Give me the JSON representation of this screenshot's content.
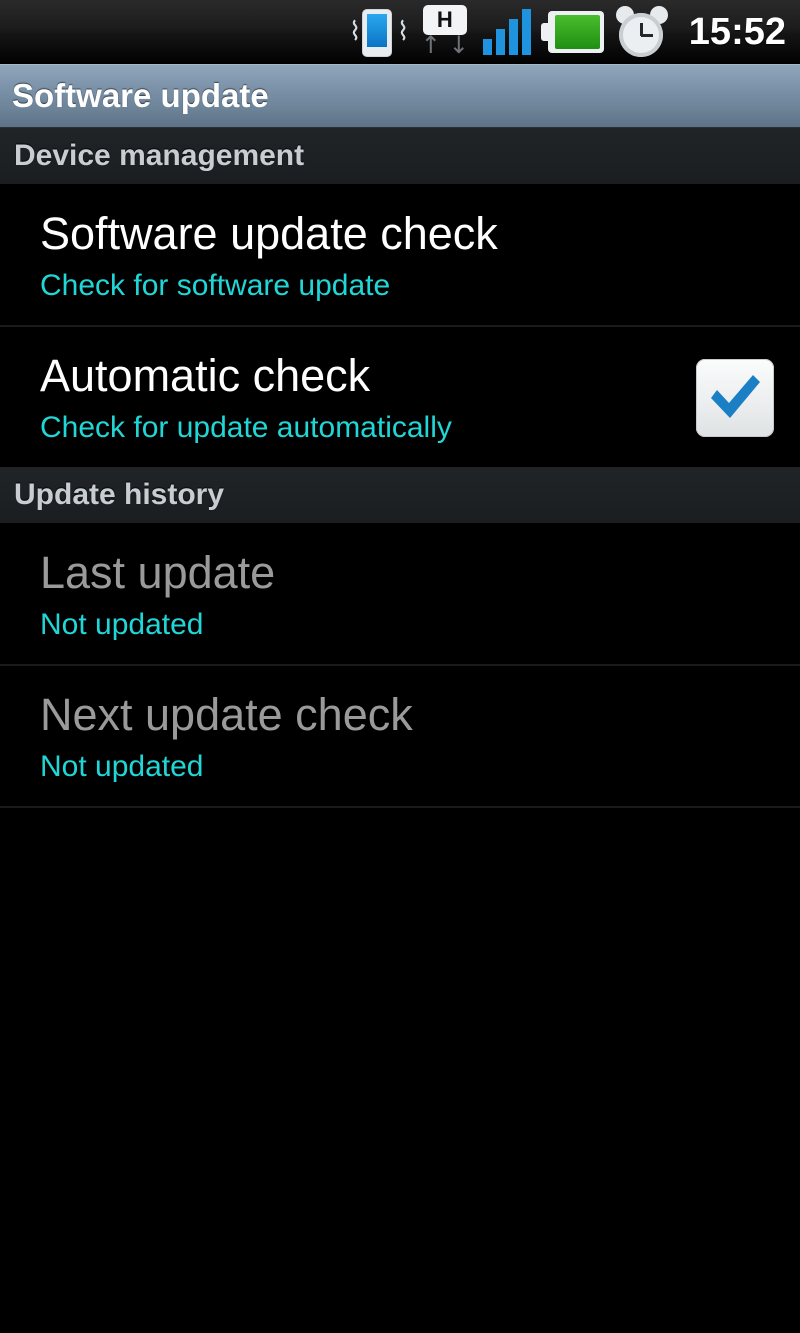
{
  "status_bar": {
    "time": "15:52",
    "icons": [
      {
        "name": "vibrate-icon",
        "label": "Vibrate mode"
      },
      {
        "name": "hspa-data-icon",
        "label": "H",
        "sublabel": "HSPA data transfer"
      },
      {
        "name": "signal-bars-icon",
        "label": "Signal strength 4 of 4"
      },
      {
        "name": "battery-icon",
        "label": "Battery full"
      },
      {
        "name": "alarm-clock-icon",
        "label": "Alarm set"
      }
    ],
    "hspa_letter": "H",
    "arrow_up": "↑",
    "arrow_down": "↓",
    "vibrate_wave": "⌇"
  },
  "title_bar": {
    "title": "Software update"
  },
  "sections": [
    {
      "header": "Device management",
      "rows": [
        {
          "name": "software-update-check",
          "title": "Software update check",
          "subtitle": "Check for software update",
          "enabled": true,
          "control": "none"
        },
        {
          "name": "automatic-check",
          "title": "Automatic check",
          "subtitle": "Check for update automatically",
          "enabled": true,
          "control": "checkbox",
          "checked": true
        }
      ]
    },
    {
      "header": "Update history",
      "rows": [
        {
          "name": "last-update",
          "title": "Last update",
          "subtitle": "Not updated",
          "enabled": false,
          "control": "none"
        },
        {
          "name": "next-update-check",
          "title": "Next update check",
          "subtitle": "Not updated",
          "enabled": false,
          "control": "none"
        }
      ]
    }
  ],
  "colors": {
    "background": "#000000",
    "title_bar_top": "#8fa6bb",
    "title_bar_bottom": "#5d7287",
    "section_header_bg": "#1e2124",
    "subtitle_cyan": "#21d6d6",
    "title_white": "#ffffff",
    "title_disabled": "#9a9a9a",
    "checkbox_check_blue": "#1a7fc4",
    "signal_blue": "#1f93de",
    "battery_green": "#2eab1f",
    "divider": "#1b1b1b"
  }
}
